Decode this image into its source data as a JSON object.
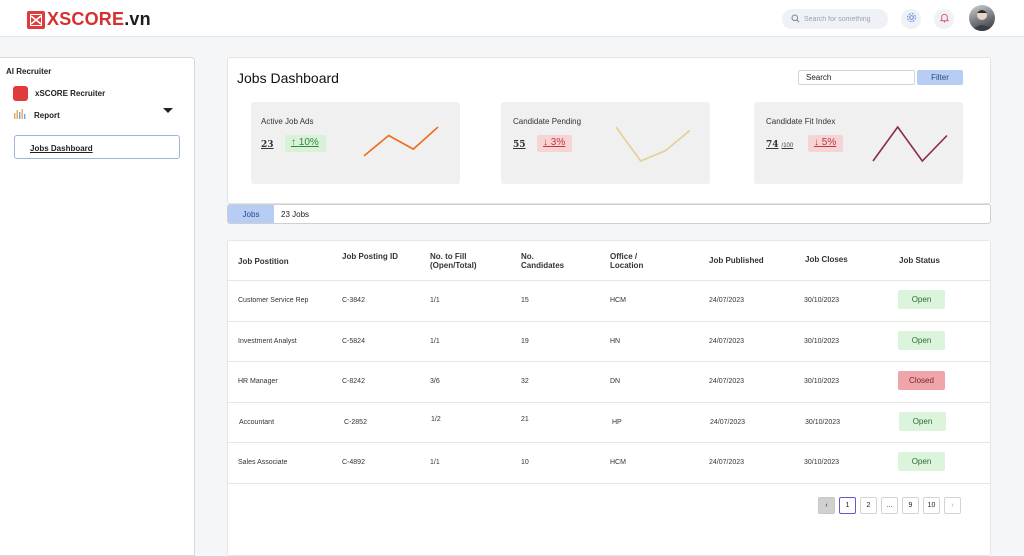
{
  "brand": {
    "name": "XSCORE",
    "suffix": ".vn"
  },
  "topbar": {
    "search_placeholder": "Search for something",
    "icons": [
      "search-icon",
      "gear-icon",
      "bell-icon"
    ]
  },
  "sidebar": {
    "title": "AI Recruiter",
    "items": [
      {
        "label": "xSCORE Recruiter",
        "icon": "xscore-logo-icon"
      },
      {
        "label": "Report",
        "icon": "bar-chart-icon"
      }
    ],
    "active_item": "Jobs Dashboard"
  },
  "dashboard": {
    "title": "Jobs Dashboard",
    "search_value": "Search",
    "filter_label": "Filter"
  },
  "kpis": [
    {
      "label": "Active Job Ads",
      "value": "23",
      "unit": "",
      "delta": "10%",
      "direction": "up",
      "arrow": "↑",
      "color": "#ef6c1a",
      "trend": [
        0.15,
        0.75,
        0.35,
        1.0
      ]
    },
    {
      "label": "Candidate Pending",
      "value": "55",
      "unit": "",
      "delta": "3%",
      "direction": "down",
      "arrow": "↓",
      "color": "#e2cf95",
      "trend": [
        1.0,
        0.0,
        0.3,
        0.9
      ]
    },
    {
      "label": "Candidate Fit Index",
      "value": "74",
      "unit": "/100",
      "delta": "5%",
      "direction": "down",
      "arrow": "↓",
      "color": "#8a2a4d",
      "trend": [
        0.0,
        1.0,
        0.0,
        0.75
      ]
    }
  ],
  "jobs_tab": {
    "label": "Jobs",
    "count": "23 Jobs"
  },
  "table": {
    "headers": [
      "Job Postition",
      "Job Posting ID",
      "No. to Fill (Open/Total)",
      "No. Candidates",
      "Office / Location",
      "Job Published",
      "Job Closes",
      "Job Status"
    ],
    "rows": [
      {
        "position": "Customer Service Rep",
        "id": "C-3842",
        "fill": "1/1",
        "candidates": "15",
        "office": "HCM",
        "published": "24/07/2023",
        "closes": "30/10/2023",
        "status": "Open"
      },
      {
        "position": "Investment Analyst",
        "id": "C-5824",
        "fill": "1/1",
        "candidates": "19",
        "office": "HN",
        "published": "24/07/2023",
        "closes": "30/10/2023",
        "status": "Open"
      },
      {
        "position": "HR Manager",
        "id": "C-8242",
        "fill": "3/6",
        "candidates": "32",
        "office": "DN",
        "published": "24/07/2023",
        "closes": "30/10/2023",
        "status": "Closed"
      },
      {
        "position": "Accountant",
        "id": "C-2852",
        "fill": "1/2",
        "candidates": "21",
        "office": "HP",
        "published": "24/07/2023",
        "closes": "30/10/2023",
        "status": "Open"
      },
      {
        "position": "Sales Associate",
        "id": "C-4892",
        "fill": "1/1",
        "candidates": "10",
        "office": "HCM",
        "published": "24/07/2023",
        "closes": "30/10/2023",
        "status": "Open"
      }
    ]
  },
  "pagination": {
    "pages": [
      "1",
      "2",
      "...",
      "9",
      "10"
    ],
    "current": "1",
    "prev": "‹",
    "next": "›"
  }
}
